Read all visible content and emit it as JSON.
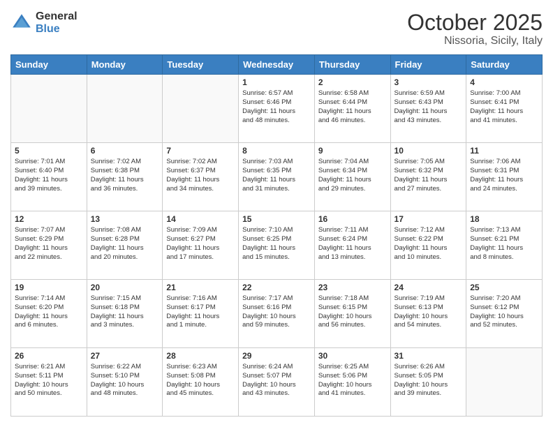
{
  "logo": {
    "general": "General",
    "blue": "Blue"
  },
  "title": "October 2025",
  "subtitle": "Nissoria, Sicily, Italy",
  "header_days": [
    "Sunday",
    "Monday",
    "Tuesday",
    "Wednesday",
    "Thursday",
    "Friday",
    "Saturday"
  ],
  "weeks": [
    [
      {
        "day": "",
        "info": ""
      },
      {
        "day": "",
        "info": ""
      },
      {
        "day": "",
        "info": ""
      },
      {
        "day": "1",
        "info": "Sunrise: 6:57 AM\nSunset: 6:46 PM\nDaylight: 11 hours\nand 48 minutes."
      },
      {
        "day": "2",
        "info": "Sunrise: 6:58 AM\nSunset: 6:44 PM\nDaylight: 11 hours\nand 46 minutes."
      },
      {
        "day": "3",
        "info": "Sunrise: 6:59 AM\nSunset: 6:43 PM\nDaylight: 11 hours\nand 43 minutes."
      },
      {
        "day": "4",
        "info": "Sunrise: 7:00 AM\nSunset: 6:41 PM\nDaylight: 11 hours\nand 41 minutes."
      }
    ],
    [
      {
        "day": "5",
        "info": "Sunrise: 7:01 AM\nSunset: 6:40 PM\nDaylight: 11 hours\nand 39 minutes."
      },
      {
        "day": "6",
        "info": "Sunrise: 7:02 AM\nSunset: 6:38 PM\nDaylight: 11 hours\nand 36 minutes."
      },
      {
        "day": "7",
        "info": "Sunrise: 7:02 AM\nSunset: 6:37 PM\nDaylight: 11 hours\nand 34 minutes."
      },
      {
        "day": "8",
        "info": "Sunrise: 7:03 AM\nSunset: 6:35 PM\nDaylight: 11 hours\nand 31 minutes."
      },
      {
        "day": "9",
        "info": "Sunrise: 7:04 AM\nSunset: 6:34 PM\nDaylight: 11 hours\nand 29 minutes."
      },
      {
        "day": "10",
        "info": "Sunrise: 7:05 AM\nSunset: 6:32 PM\nDaylight: 11 hours\nand 27 minutes."
      },
      {
        "day": "11",
        "info": "Sunrise: 7:06 AM\nSunset: 6:31 PM\nDaylight: 11 hours\nand 24 minutes."
      }
    ],
    [
      {
        "day": "12",
        "info": "Sunrise: 7:07 AM\nSunset: 6:29 PM\nDaylight: 11 hours\nand 22 minutes."
      },
      {
        "day": "13",
        "info": "Sunrise: 7:08 AM\nSunset: 6:28 PM\nDaylight: 11 hours\nand 20 minutes."
      },
      {
        "day": "14",
        "info": "Sunrise: 7:09 AM\nSunset: 6:27 PM\nDaylight: 11 hours\nand 17 minutes."
      },
      {
        "day": "15",
        "info": "Sunrise: 7:10 AM\nSunset: 6:25 PM\nDaylight: 11 hours\nand 15 minutes."
      },
      {
        "day": "16",
        "info": "Sunrise: 7:11 AM\nSunset: 6:24 PM\nDaylight: 11 hours\nand 13 minutes."
      },
      {
        "day": "17",
        "info": "Sunrise: 7:12 AM\nSunset: 6:22 PM\nDaylight: 11 hours\nand 10 minutes."
      },
      {
        "day": "18",
        "info": "Sunrise: 7:13 AM\nSunset: 6:21 PM\nDaylight: 11 hours\nand 8 minutes."
      }
    ],
    [
      {
        "day": "19",
        "info": "Sunrise: 7:14 AM\nSunset: 6:20 PM\nDaylight: 11 hours\nand 6 minutes."
      },
      {
        "day": "20",
        "info": "Sunrise: 7:15 AM\nSunset: 6:18 PM\nDaylight: 11 hours\nand 3 minutes."
      },
      {
        "day": "21",
        "info": "Sunrise: 7:16 AM\nSunset: 6:17 PM\nDaylight: 11 hours\nand 1 minute."
      },
      {
        "day": "22",
        "info": "Sunrise: 7:17 AM\nSunset: 6:16 PM\nDaylight: 10 hours\nand 59 minutes."
      },
      {
        "day": "23",
        "info": "Sunrise: 7:18 AM\nSunset: 6:15 PM\nDaylight: 10 hours\nand 56 minutes."
      },
      {
        "day": "24",
        "info": "Sunrise: 7:19 AM\nSunset: 6:13 PM\nDaylight: 10 hours\nand 54 minutes."
      },
      {
        "day": "25",
        "info": "Sunrise: 7:20 AM\nSunset: 6:12 PM\nDaylight: 10 hours\nand 52 minutes."
      }
    ],
    [
      {
        "day": "26",
        "info": "Sunrise: 6:21 AM\nSunset: 5:11 PM\nDaylight: 10 hours\nand 50 minutes."
      },
      {
        "day": "27",
        "info": "Sunrise: 6:22 AM\nSunset: 5:10 PM\nDaylight: 10 hours\nand 48 minutes."
      },
      {
        "day": "28",
        "info": "Sunrise: 6:23 AM\nSunset: 5:08 PM\nDaylight: 10 hours\nand 45 minutes."
      },
      {
        "day": "29",
        "info": "Sunrise: 6:24 AM\nSunset: 5:07 PM\nDaylight: 10 hours\nand 43 minutes."
      },
      {
        "day": "30",
        "info": "Sunrise: 6:25 AM\nSunset: 5:06 PM\nDaylight: 10 hours\nand 41 minutes."
      },
      {
        "day": "31",
        "info": "Sunrise: 6:26 AM\nSunset: 5:05 PM\nDaylight: 10 hours\nand 39 minutes."
      },
      {
        "day": "",
        "info": ""
      }
    ]
  ]
}
